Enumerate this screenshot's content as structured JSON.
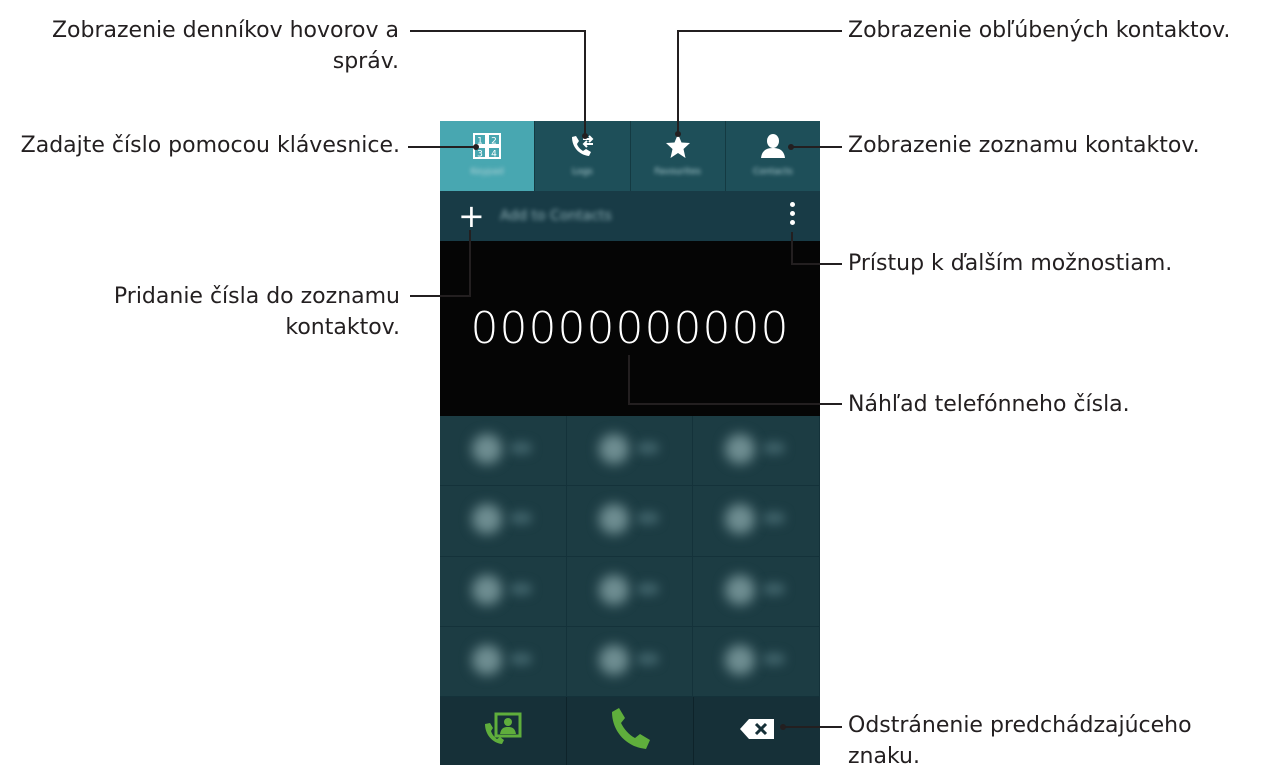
{
  "callouts": {
    "logs": [
      "Zobrazenie denníkov hovorov a",
      "správ."
    ],
    "favorites": "Zobrazenie obľúbených kontaktov.",
    "keypad": "Zadajte číslo pomocou klávesnice.",
    "contacts": "Zobrazenie zoznamu kontaktov.",
    "more_options": "Prístup k ďalším možnostiam.",
    "add_number": [
      "Pridanie čísla do zoznamu",
      "kontaktov."
    ],
    "preview": "Náhľad telefónneho čísla.",
    "delete_char": [
      "Odstránenie predchádzajúceho",
      "znaku."
    ]
  },
  "phone": {
    "tabs": [
      {
        "label": "Keypad",
        "icon": "keypad-icon",
        "active": true
      },
      {
        "label": "Logs",
        "icon": "call-log-icon",
        "active": false
      },
      {
        "label": "Favourites",
        "icon": "star-icon",
        "active": false
      },
      {
        "label": "Contacts",
        "icon": "person-icon",
        "active": false
      }
    ],
    "add_to_contacts": "Add to Contacts",
    "number": "00000000000",
    "bottom_buttons": [
      "contacts-call-icon",
      "phone-call-icon",
      "backspace-icon"
    ]
  },
  "colors": {
    "active_tab": "#48a7b1",
    "tab": "#1e4f59",
    "call_green": "#5fae3c"
  }
}
